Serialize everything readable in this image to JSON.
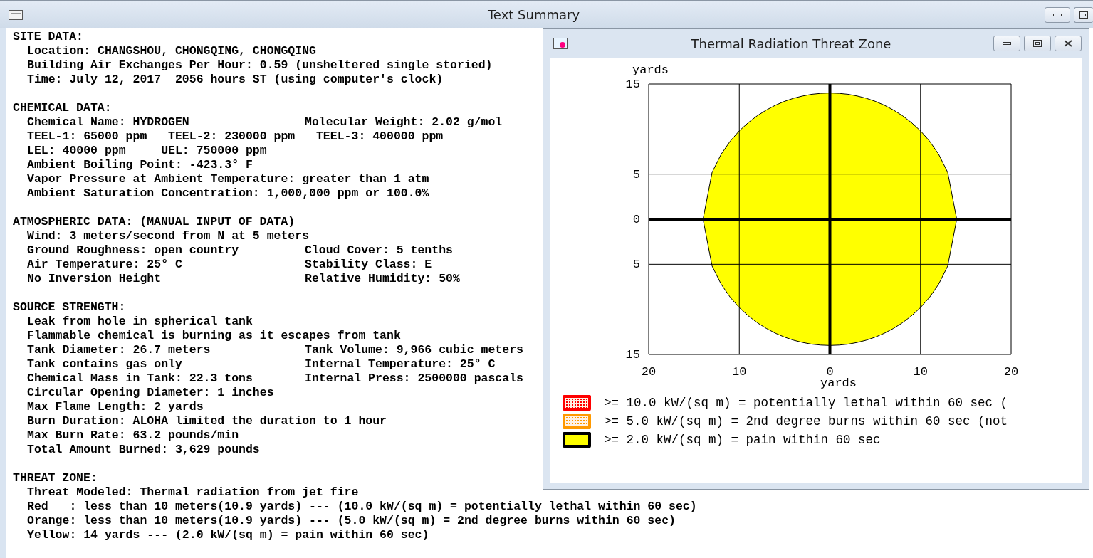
{
  "window": {
    "title": "Text Summary"
  },
  "summary": [
    {
      "heading": "SITE DATA:",
      "lines": [
        {
          "text": "Location: CHANGSHOU, CHONGQING, CHONGQING"
        },
        {
          "text": "Building Air Exchanges Per Hour: 0.59 (unsheltered single storied)"
        },
        {
          "text": "Time: July 12, 2017  2056 hours ST (using computer's clock)"
        }
      ]
    },
    {
      "heading": "CHEMICAL DATA:",
      "lines": [
        {
          "text": "Chemical Name: HYDROGEN",
          "right": "Molecular Weight: 2.02 g/mol"
        },
        {
          "text": "TEEL-1: 65000 ppm   TEEL-2: 230000 ppm   TEEL-3: 400000 ppm"
        },
        {
          "text": "LEL: 40000 ppm     UEL: 750000 ppm"
        },
        {
          "text": "Ambient Boiling Point: -423.3° F"
        },
        {
          "text": "Vapor Pressure at Ambient Temperature: greater than 1 atm"
        },
        {
          "text": "Ambient Saturation Concentration: 1,000,000 ppm or 100.0%"
        }
      ]
    },
    {
      "heading": "ATMOSPHERIC DATA: (MANUAL INPUT OF DATA)",
      "lines": [
        {
          "text": "Wind: 3 meters/second from N at 5 meters"
        },
        {
          "text": "Ground Roughness: open country",
          "right": "Cloud Cover: 5 tenths"
        },
        {
          "text": "Air Temperature: 25° C",
          "right": "Stability Class: E"
        },
        {
          "text": "No Inversion Height",
          "right": "Relative Humidity: 50%"
        }
      ]
    },
    {
      "heading": "SOURCE STRENGTH:",
      "lines": [
        {
          "text": "Leak from hole in spherical tank"
        },
        {
          "text": "Flammable chemical is burning as it escapes from tank"
        },
        {
          "text": "Tank Diameter: 26.7 meters",
          "right": "Tank Volume: 9,966 cubic meters"
        },
        {
          "text": "Tank contains gas only",
          "right": "Internal Temperature: 25° C"
        },
        {
          "text": "Chemical Mass in Tank: 22.3 tons",
          "right": "Internal Press: 2500000 pascals"
        },
        {
          "text": "Circular Opening Diameter: 1 inches"
        },
        {
          "text": "Max Flame Length: 2 yards"
        },
        {
          "text": "Burn Duration: ALOHA limited the duration to 1 hour"
        },
        {
          "text": "Max Burn Rate: 63.2 pounds/min"
        },
        {
          "text": "Total Amount Burned: 3,629 pounds"
        }
      ]
    },
    {
      "heading": "THREAT ZONE:",
      "lines": [
        {
          "text": "Threat Modeled: Thermal radiation from jet fire"
        },
        {
          "text": "Red   : less than 10 meters(10.9 yards) --- (10.0 kW/(sq m) = potentially lethal within 60 sec)"
        },
        {
          "text": "Orange: less than 10 meters(10.9 yards) --- (5.0 kW/(sq m) = 2nd degree burns within 60 sec)"
        },
        {
          "text": "Yellow: 14 yards --- (2.0 kW/(sq m) = pain within 60 sec)"
        }
      ]
    }
  ],
  "plot_window": {
    "title": "Thermal Radiation Threat Zone",
    "chart_data": {
      "type": "area",
      "xlabel": "yards",
      "ylabel": "yards",
      "xlim": [
        -20,
        20
      ],
      "ylim": [
        -15,
        15
      ],
      "xticks": [
        {
          "value": -20,
          "label": "20"
        },
        {
          "value": -10,
          "label": "10"
        },
        {
          "value": 0,
          "label": "0"
        },
        {
          "value": 10,
          "label": "10"
        },
        {
          "value": 20,
          "label": "20"
        }
      ],
      "yticks": [
        {
          "value": 15,
          "label": "15"
        },
        {
          "value": 5,
          "label": "5"
        },
        {
          "value": 0,
          "label": "0"
        },
        {
          "value": -5,
          "label": "5"
        },
        {
          "value": -15,
          "label": "15"
        }
      ],
      "grid": true,
      "x": [
        -14,
        -13,
        -12,
        -11,
        -10,
        -9,
        -8,
        -7,
        -6,
        -5,
        -4,
        -3,
        -2,
        -1,
        0,
        1,
        2,
        3,
        4,
        5,
        6,
        7,
        8,
        9,
        10,
        11,
        12,
        13,
        14
      ],
      "series": [
        {
          "color": "#ffff00",
          "values": [
            0,
            5.2,
            7.21,
            8.66,
            9.8,
            10.72,
            11.49,
            12.12,
            12.65,
            13.08,
            13.42,
            13.67,
            13.86,
            13.96,
            14,
            13.96,
            13.86,
            13.67,
            13.42,
            13.08,
            12.65,
            12.12,
            11.49,
            10.72,
            9.8,
            8.66,
            7.21,
            5.2,
            0
          ]
        },
        {
          "color": "#ffff00",
          "values": [
            0,
            -5.2,
            -7.21,
            -8.66,
            -9.8,
            -10.72,
            -11.49,
            -12.12,
            -12.65,
            -13.08,
            -13.42,
            -13.67,
            -13.86,
            -13.96,
            -14,
            -13.96,
            -13.86,
            -13.67,
            -13.42,
            -13.08,
            -12.65,
            -12.12,
            -11.49,
            -10.72,
            -9.8,
            -8.66,
            -7.21,
            -5.2,
            0
          ]
        }
      ]
    },
    "legend": [
      {
        "kind": "dotted",
        "color": "#ff0000",
        "text": ">= 10.0 kW/(sq m) = potentially lethal within 60 sec ("
      },
      {
        "kind": "dotted",
        "color": "#ff9900",
        "text": ">= 5.0 kW/(sq m) = 2nd degree burns within 60 sec (not"
      },
      {
        "kind": "solid",
        "color": "#ffff00",
        "text": ">= 2.0 kW/(sq m) = pain within 60 sec"
      }
    ]
  }
}
